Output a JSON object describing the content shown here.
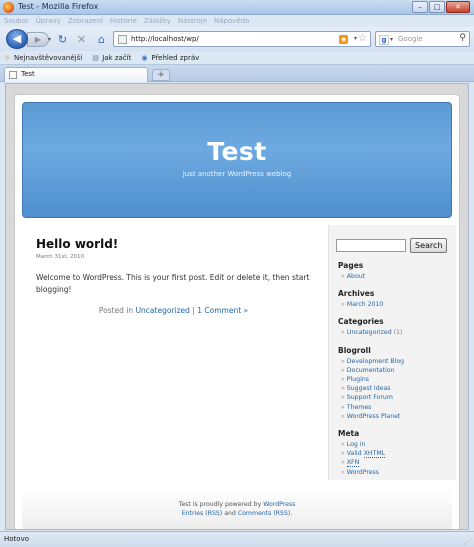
{
  "window": {
    "title": "Test - Mozilla Firefox",
    "controls": {
      "minimize": "–",
      "maximize": "□",
      "close": "✕"
    }
  },
  "menu": [
    "Soubor",
    "Úpravy",
    "Zobrazení",
    "Historie",
    "Záložky",
    "Nástroje",
    "Nápověda"
  ],
  "navigation": {
    "back_icon": "◀",
    "forward_icon": "▶",
    "dropdown_icon": "▾",
    "reload_icon": "↻",
    "stop_icon": "✕",
    "home_icon": "⌂",
    "url": "http://localhost/wp/",
    "rss_icon": "◉",
    "star_icon": "☆",
    "search_engine_icon": "g",
    "search_placeholder": "Google",
    "search_icon": "⚲"
  },
  "bookmarks": [
    {
      "label": "Nejnavštěvovanější",
      "icon": "☼"
    },
    {
      "label": "Jak začít",
      "icon": "▤"
    },
    {
      "label": "Přehled zpráv",
      "icon": "◉"
    }
  ],
  "tabs": [
    {
      "label": "Test"
    }
  ],
  "new_tab_label": "+",
  "blog": {
    "title": "Test",
    "description": "Just another WordPress weblog"
  },
  "post": {
    "title": "Hello world!",
    "date": "March 31st, 2010",
    "body": "Welcome to WordPress. This is your first post. Edit or delete it, then start blogging!",
    "posted_in_prefix": "Posted in",
    "category": "Uncategorized",
    "separator": "|",
    "comments": "1 Comment »"
  },
  "sidebar": {
    "search_button": "Search",
    "pages_heading": "Pages",
    "pages": [
      "About"
    ],
    "archives_heading": "Archives",
    "archives": [
      "March 2010"
    ],
    "categories_heading": "Categories",
    "categories": [
      {
        "name": "Uncategorized",
        "count": "(1)"
      }
    ],
    "blogroll_heading": "Blogroll",
    "blogroll": [
      "Development Blog",
      "Documentation",
      "Plugins",
      "Suggest Ideas",
      "Support Forum",
      "Themes",
      "WordPress Planet"
    ],
    "meta_heading": "Meta",
    "meta_login": "Log in",
    "meta_valid_prefix": "Valid ",
    "meta_valid_abbr": "XHTML",
    "meta_xfn": "XFN",
    "meta_wordpress": "WordPress",
    "bullet": "»"
  },
  "footer": {
    "text_prefix": "Test is proudly powered by",
    "wordpress_link": "WordPress",
    "entries_link": "Entries (RSS)",
    "and_text": "and",
    "comments_link": "Comments (RSS)",
    "end": "."
  },
  "status": {
    "text": "Hotovo",
    "grip": "⋰"
  }
}
